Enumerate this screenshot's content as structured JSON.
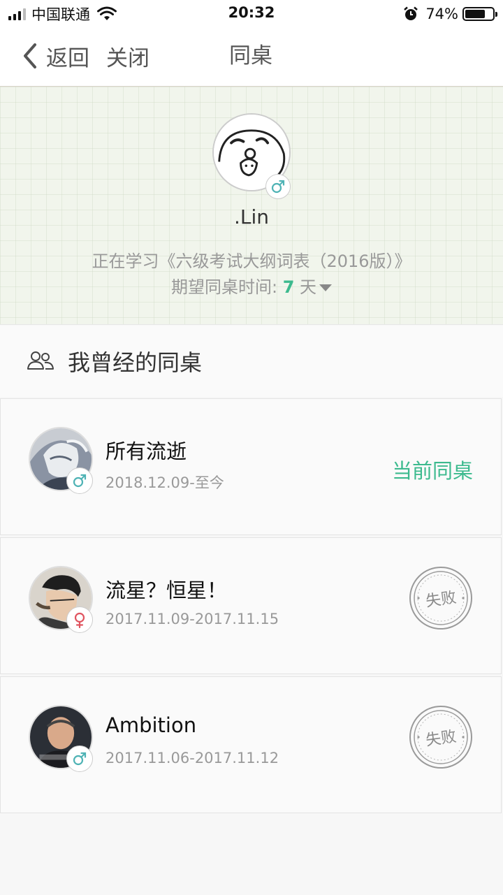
{
  "status_bar": {
    "carrier": "中国联通",
    "time": "20:32",
    "battery_pct": "74%",
    "battery_level": 0.74
  },
  "nav": {
    "back_label": "返回",
    "close_label": "关闭",
    "title": "同桌"
  },
  "profile": {
    "name": ".Lin",
    "gender": "male",
    "studying": "正在学习《六级考试大纲词表（2016版）》",
    "expect_prefix": "期望同桌时间: ",
    "expect_days": "7",
    "expect_unit": " 天"
  },
  "history": {
    "title": "我曾经的同桌",
    "partners": [
      {
        "name": "所有流逝",
        "dates": "2018.12.09-至今",
        "gender": "male",
        "status": "当前同桌"
      },
      {
        "name": "流星？恒星！",
        "dates": "2017.11.09-2017.11.15",
        "gender": "female",
        "status": "失败"
      },
      {
        "name": "Ambition",
        "dates": "2017.11.06-2017.11.12",
        "gender": "male",
        "status": "失败"
      }
    ]
  },
  "colors": {
    "accent": "#3cba8e",
    "male": "#4fb3b5",
    "female": "#e05560",
    "stamp": "#9a9a9a"
  }
}
